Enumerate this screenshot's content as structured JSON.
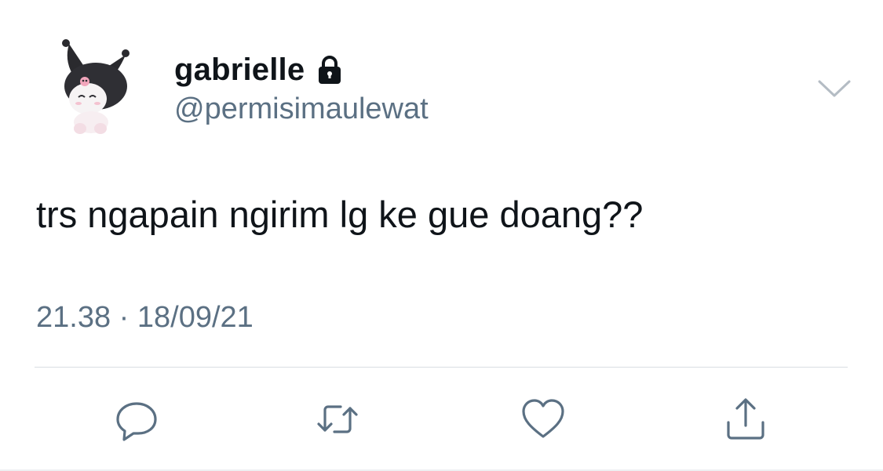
{
  "tweet": {
    "author": {
      "display_name": "gabrielle",
      "handle": "@permisimaulewat",
      "protected_icon": "lock-icon",
      "avatar_icon": "kuromi-avatar"
    },
    "text": "trs ngapain ngirim lg ke gue doang??",
    "timestamp": "21.38 · 18/09/21",
    "menu_icon": "chevron-down-icon"
  },
  "actions": [
    {
      "name": "reply",
      "icon": "reply-icon"
    },
    {
      "name": "retweet",
      "icon": "retweet-icon"
    },
    {
      "name": "like",
      "icon": "heart-icon"
    },
    {
      "name": "share",
      "icon": "share-icon"
    }
  ],
  "colors": {
    "text_primary": "#0f1419",
    "text_secondary": "#5b7083",
    "icon": "#5b7083",
    "divider": "#d9dee3"
  }
}
